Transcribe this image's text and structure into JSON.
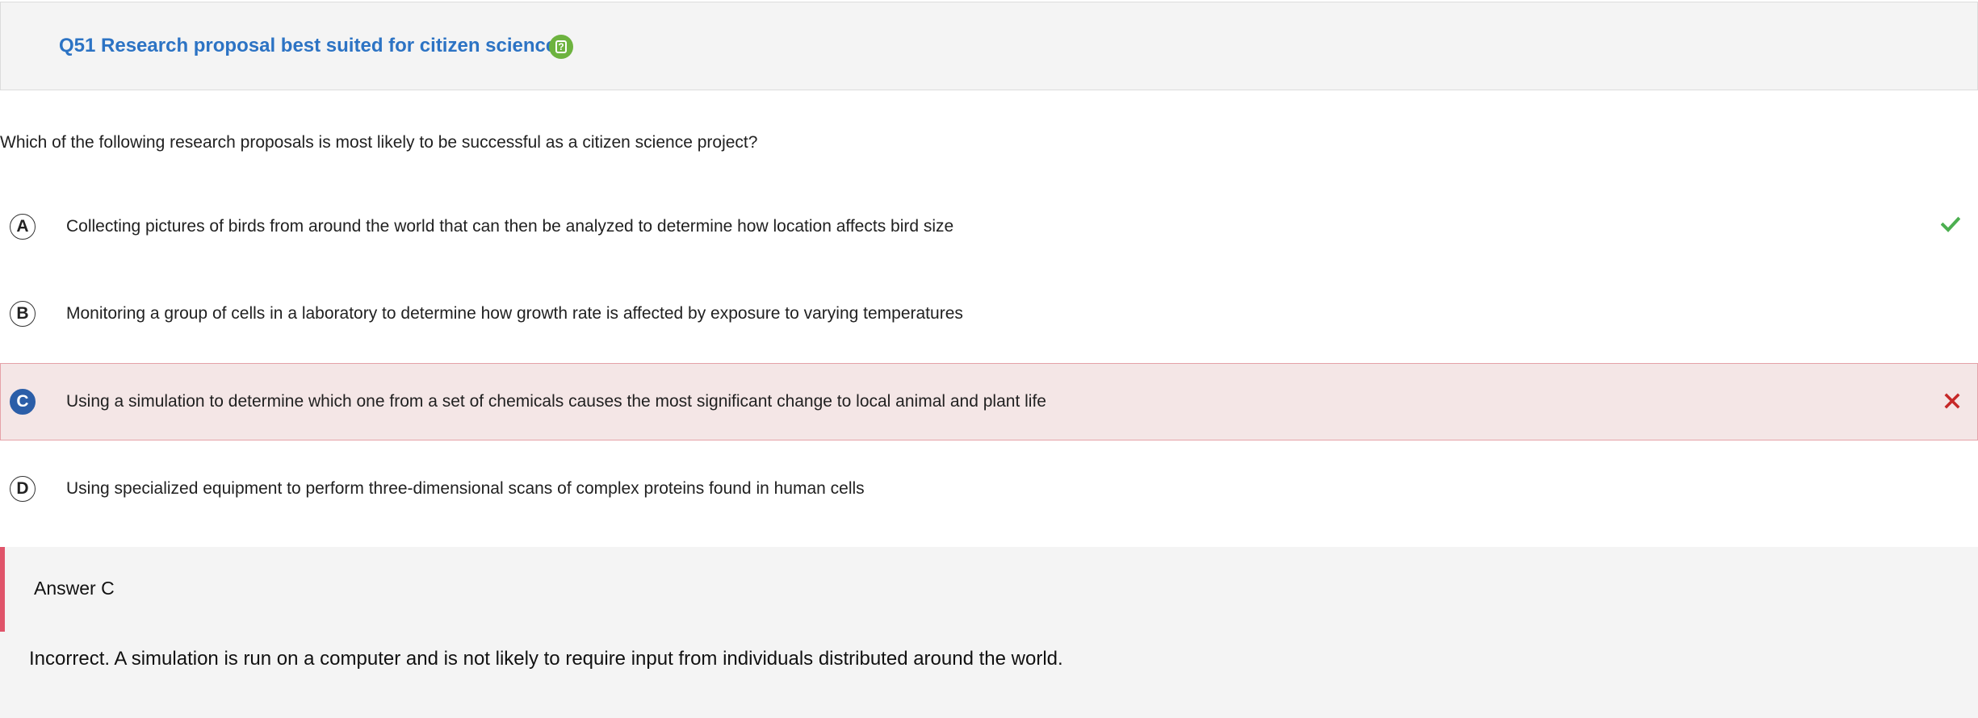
{
  "header": {
    "title": "Q51 Research proposal best suited for citizen science",
    "help_icon_glyph": "?",
    "help_icon": "help-icon",
    "title_color": "#2c73c4"
  },
  "question": {
    "prompt": "Which of the following research proposals is most likely to be successful as a citizen science project?"
  },
  "options": [
    {
      "letter": "A",
      "text": "Collecting pictures of birds from around the world that can then be analyzed to determine how location affects bird size",
      "state": "correct",
      "icon": "check-icon",
      "icon_color": "#4caf50"
    },
    {
      "letter": "B",
      "text": "Monitoring a group of cells in a laboratory to determine how growth rate is affected by exposure to varying temperatures",
      "state": "none"
    },
    {
      "letter": "C",
      "text": "Using a simulation to determine which one from a set of chemicals causes the most significant change to local animal and plant life",
      "state": "selected-incorrect",
      "icon": "x-icon",
      "icon_color": "#c62828"
    },
    {
      "letter": "D",
      "text": "Using specialized equipment to perform three-dimensional scans of complex proteins found in human cells",
      "state": "none"
    }
  ],
  "answer": {
    "label": "Answer C",
    "accent_color": "#e0546a",
    "feedback": "Incorrect. A simulation is run on a computer and is not likely to require input from individuals distributed around the world."
  }
}
